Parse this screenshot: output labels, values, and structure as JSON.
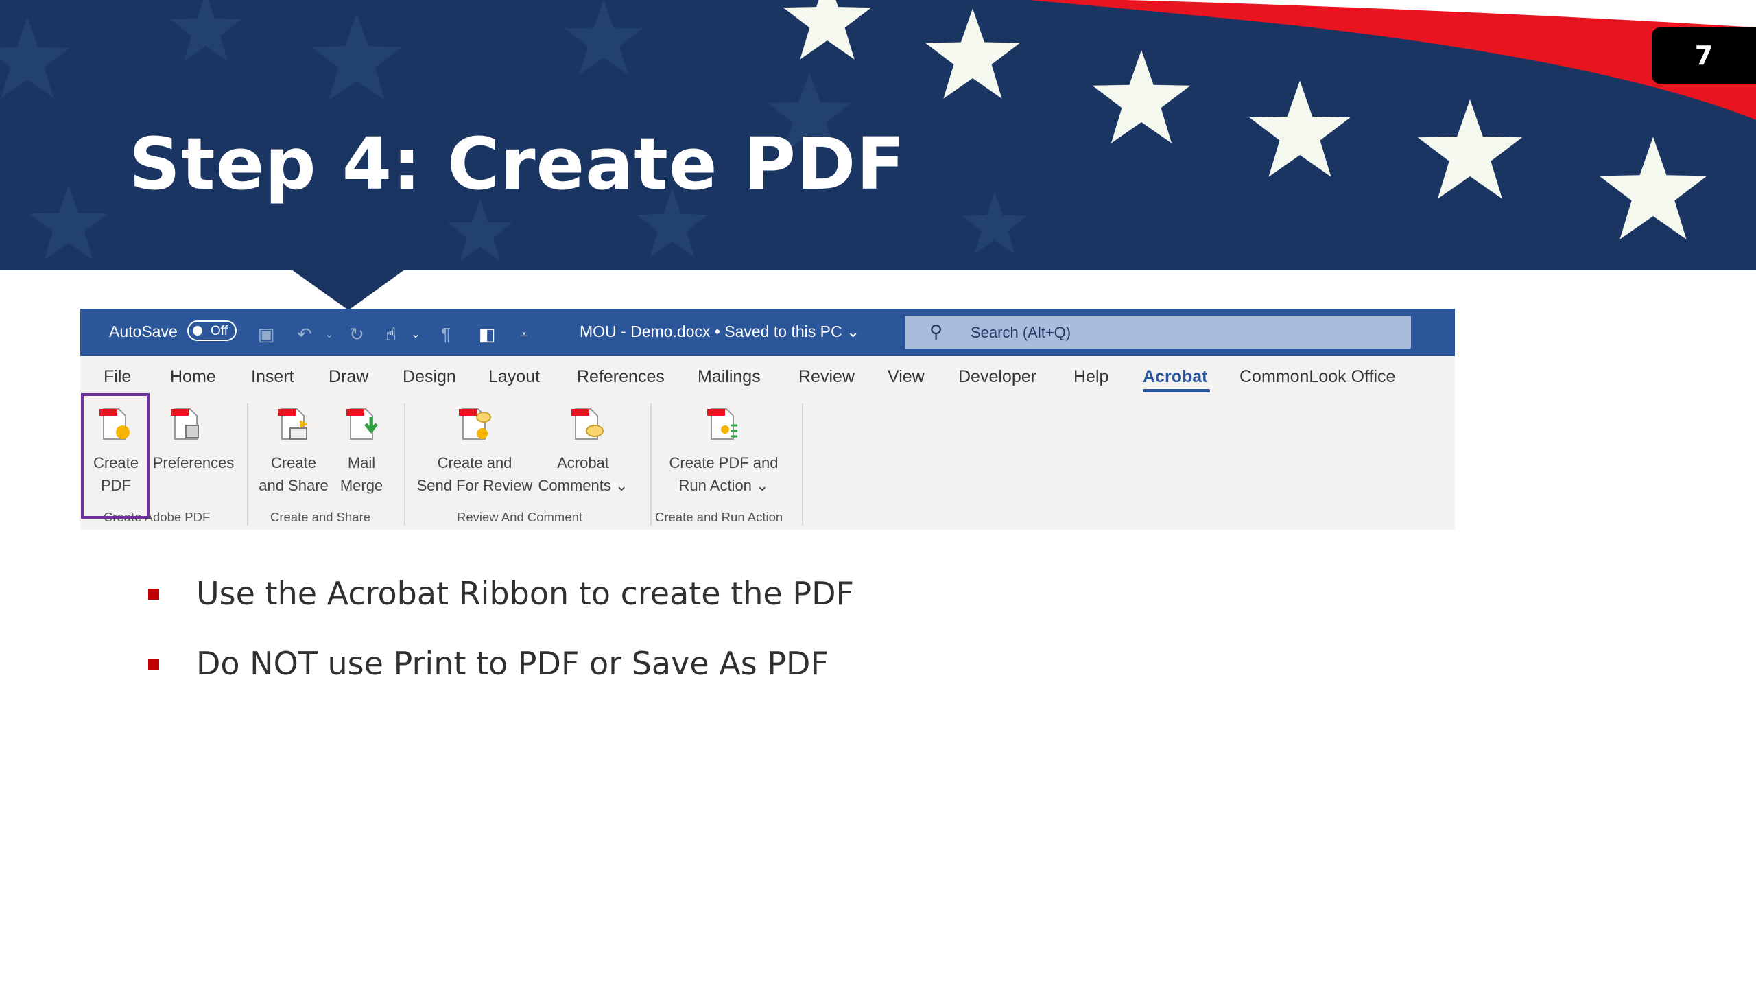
{
  "slide": {
    "title": "Step 4: Create PDF",
    "number": "7",
    "colors": {
      "navy": "#1b3563",
      "red": "#e8141f",
      "star": "#f5f8ee",
      "bullet": "#c00000"
    }
  },
  "word": {
    "autosave_label": "AutoSave",
    "autosave_state": "Off",
    "doc_title": "MOU - Demo.docx • Saved to this PC ⌄",
    "search_placeholder": "Search (Alt+Q)",
    "quick_access_icons": [
      "save-icon",
      "undo-icon",
      "redo-icon",
      "touch-mode-icon",
      "paragraph-icon",
      "layout-icon",
      "customize-icon"
    ],
    "tabs": [
      "File",
      "Home",
      "Insert",
      "Draw",
      "Design",
      "Layout",
      "References",
      "Mailings",
      "Review",
      "View",
      "Developer",
      "Help",
      "Acrobat",
      "CommonLook Office"
    ],
    "active_tab": "Acrobat",
    "commands": {
      "create_pdf": [
        "Create",
        "PDF"
      ],
      "preferences": [
        "Preferences"
      ],
      "create_share": [
        "Create",
        "and Share"
      ],
      "mail_merge": [
        "Mail",
        "Merge"
      ],
      "create_send": [
        "Create and",
        "Send For Review"
      ],
      "acrobat_comments": [
        "Acrobat",
        "Comments ⌄"
      ],
      "create_run": [
        "Create PDF and",
        "Run Action ⌄"
      ]
    },
    "groups": [
      "Create Adobe PDF",
      "Create and Share",
      "Review And Comment",
      "Create and Run Action"
    ],
    "colors": {
      "titlebar": "#2b579a",
      "ribbon": "#f3f2f1",
      "highlight": "#7030a0"
    }
  },
  "bullets": [
    "Use the Acrobat Ribbon to create the PDF",
    "Do NOT use Print to PDF or Save As PDF"
  ]
}
